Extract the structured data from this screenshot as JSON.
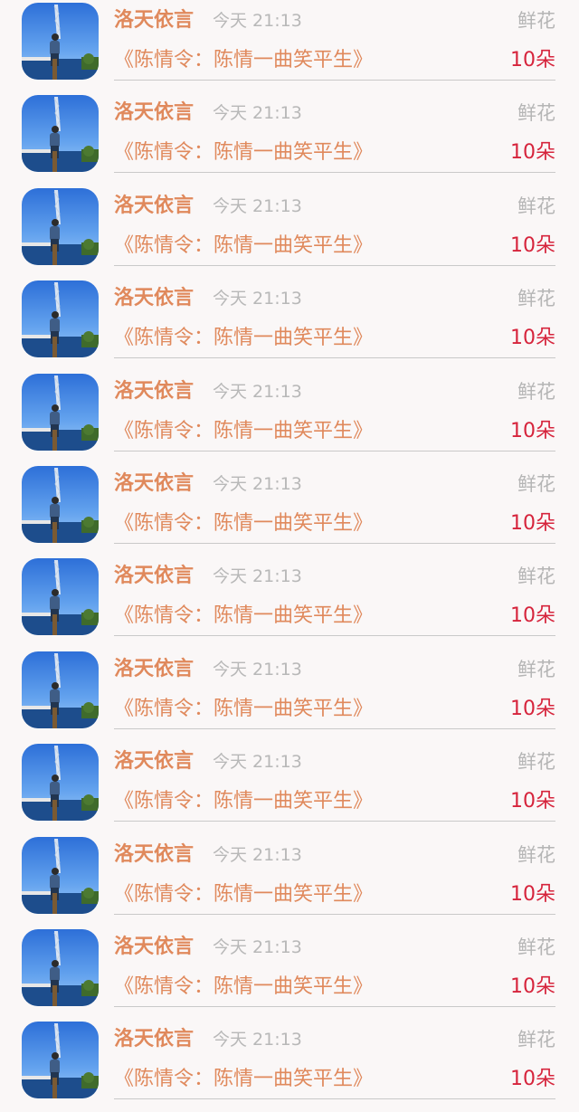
{
  "gift_list": {
    "items": [
      {
        "user": "洛天依言",
        "time": "今天 21:13",
        "gift_name": "鲜花",
        "work": "《陈情令：陈情一曲笑平生》",
        "amount": "10朵"
      },
      {
        "user": "洛天依言",
        "time": "今天 21:13",
        "gift_name": "鲜花",
        "work": "《陈情令：陈情一曲笑平生》",
        "amount": "10朵"
      },
      {
        "user": "洛天依言",
        "time": "今天 21:13",
        "gift_name": "鲜花",
        "work": "《陈情令：陈情一曲笑平生》",
        "amount": "10朵"
      },
      {
        "user": "洛天依言",
        "time": "今天 21:13",
        "gift_name": "鲜花",
        "work": "《陈情令：陈情一曲笑平生》",
        "amount": "10朵"
      },
      {
        "user": "洛天依言",
        "time": "今天 21:13",
        "gift_name": "鲜花",
        "work": "《陈情令：陈情一曲笑平生》",
        "amount": "10朵"
      },
      {
        "user": "洛天依言",
        "time": "今天 21:13",
        "gift_name": "鲜花",
        "work": "《陈情令：陈情一曲笑平生》",
        "amount": "10朵"
      },
      {
        "user": "洛天依言",
        "time": "今天 21:13",
        "gift_name": "鲜花",
        "work": "《陈情令：陈情一曲笑平生》",
        "amount": "10朵"
      },
      {
        "user": "洛天依言",
        "time": "今天 21:13",
        "gift_name": "鲜花",
        "work": "《陈情令：陈情一曲笑平生》",
        "amount": "10朵"
      },
      {
        "user": "洛天依言",
        "time": "今天 21:13",
        "gift_name": "鲜花",
        "work": "《陈情令：陈情一曲笑平生》",
        "amount": "10朵"
      },
      {
        "user": "洛天依言",
        "time": "今天 21:13",
        "gift_name": "鲜花",
        "work": "《陈情令：陈情一曲笑平生》",
        "amount": "10朵"
      },
      {
        "user": "洛天依言",
        "time": "今天 21:13",
        "gift_name": "鲜花",
        "work": "《陈情令：陈情一曲笑平生》",
        "amount": "10朵"
      },
      {
        "user": "洛天依言",
        "time": "今天 21:13",
        "gift_name": "鲜花",
        "work": "《陈情令：陈情一曲笑平生》",
        "amount": "10朵"
      }
    ]
  },
  "colors": {
    "username": "#e0895c",
    "work_title": "#e0895c",
    "amount": "#d6243c",
    "secondary_text": "#b8b8b8",
    "background": "#faf7f7"
  },
  "icons": {
    "avatar": "user-photo-avatar"
  }
}
